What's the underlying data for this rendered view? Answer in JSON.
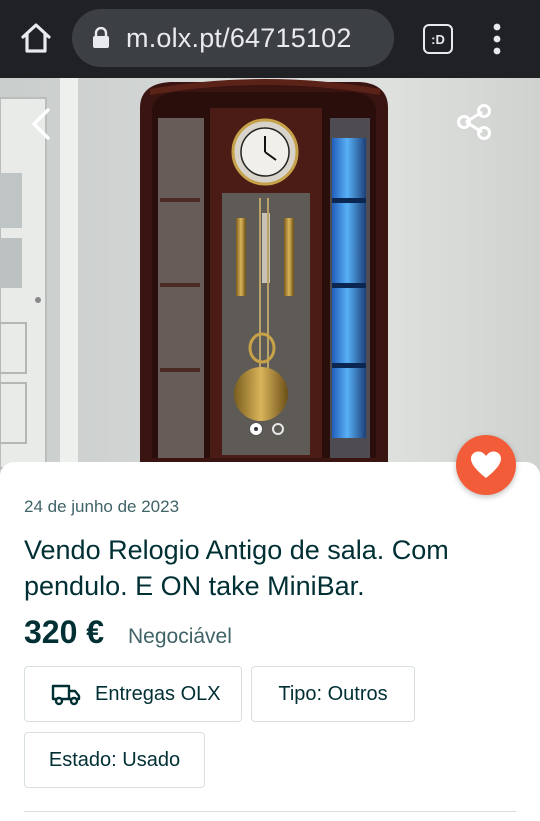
{
  "browser": {
    "url": "m.olx.pt/64715102",
    "tabs_label": ":D"
  },
  "listing": {
    "date": "24 de junho de 2023",
    "title": "Vendo Relogio Antigo de sala. Com pendulo. E ON take MiniBar.",
    "price": "320 €",
    "negotiable": "Negociável",
    "tags": {
      "delivery": "Entregas OLX",
      "type": "Tipo: Outros",
      "state": "Estado: Usado"
    }
  },
  "gallery": {
    "total_images": 2,
    "active_index": 1
  },
  "colors": {
    "accent_favorite": "#f25c38",
    "text_primary": "#002f34",
    "text_secondary": "#406367",
    "browser_bar": "#202124"
  },
  "icons": [
    "home-icon",
    "lock-icon",
    "tabs-icon",
    "more-vert-icon",
    "back-arrow-icon",
    "share-icon",
    "heart-icon",
    "truck-icon"
  ]
}
